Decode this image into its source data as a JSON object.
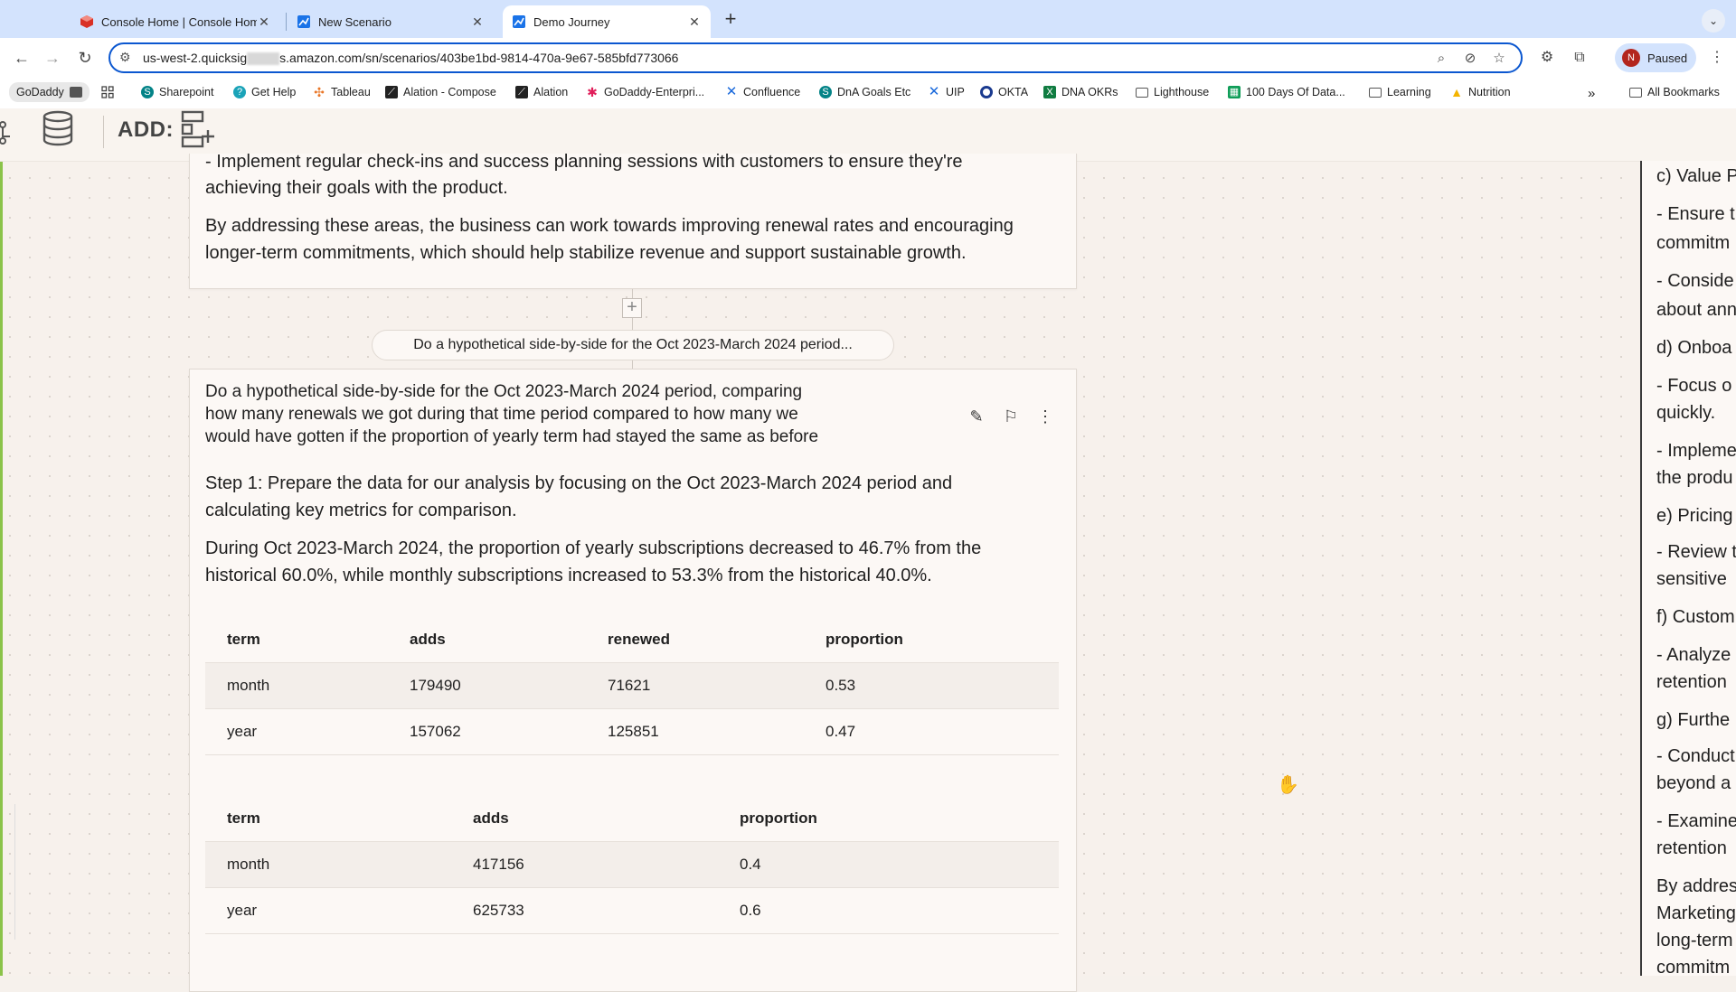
{
  "browser": {
    "tabs": [
      {
        "title": "Console Home | Console Hom",
        "active": false,
        "favicon": "aws-cube-icon",
        "color": "#d93025"
      },
      {
        "title": "New Scenario",
        "active": false,
        "favicon": "quicksight-icon",
        "color": "#1a73e8"
      },
      {
        "title": "Demo Journey",
        "active": true,
        "favicon": "quicksight-icon",
        "color": "#1a73e8"
      }
    ],
    "url_prefix": "us-west-2.quicksig",
    "url_suffix": "s.amazon.com/sn/scenarios/403be1bd-9814-470a-9e67-585bfd773066",
    "profile_initial": "N",
    "profile_status": "Paused",
    "bookmarks": [
      {
        "label": "GoDaddy",
        "icon": "godaddy-icon"
      },
      {
        "label": "Sharepoint",
        "icon": "sharepoint-icon",
        "color": "#038387"
      },
      {
        "label": "Get Help",
        "icon": "help-icon",
        "color": "#1aa3b8"
      },
      {
        "label": "Tableau",
        "icon": "tableau-icon",
        "color": "#e97627"
      },
      {
        "label": "Alation - Compose",
        "icon": "alation-icon",
        "color": "#222222"
      },
      {
        "label": "Alation",
        "icon": "alation-icon",
        "color": "#222222"
      },
      {
        "label": "GoDaddy-Enterpri...",
        "icon": "slack-icon",
        "color": "#e01e5a"
      },
      {
        "label": "Confluence",
        "icon": "confluence-icon",
        "color": "#1868db"
      },
      {
        "label": "DnA Goals Etc",
        "icon": "sharepoint-icon",
        "color": "#038387"
      },
      {
        "label": "UIP",
        "icon": "confluence-icon",
        "color": "#1868db"
      },
      {
        "label": "OKTA",
        "icon": "okta-icon",
        "color": "#1a3a8f"
      },
      {
        "label": "DNA OKRs",
        "icon": "excel-icon",
        "color": "#107c41"
      },
      {
        "label": "Lighthouse",
        "icon": "folder-icon"
      },
      {
        "label": "100 Days Of Data...",
        "icon": "sheets-icon",
        "color": "#0f9d58"
      },
      {
        "label": "Learning",
        "icon": "folder-icon"
      },
      {
        "label": "Nutrition",
        "icon": "drive-icon",
        "color": "#f4b400"
      }
    ],
    "more_bookmarks": "»",
    "all_bookmarks": "All Bookmarks"
  },
  "toolbar": {
    "add_label": "ADD:"
  },
  "top_card": {
    "line1": "- Implement regular check-ins and success planning sessions with customers to ensure they're",
    "line2": "achieving their goals with the product.",
    "para2_line1": "By addressing these areas, the business can work towards improving renewal rates and encouraging",
    "para2_line2": "longer-term commitments, which should help stabilize revenue and support sustainable growth."
  },
  "question_pill": "Do a hypothetical side-by-side for the Oct 2023-March 2024 period...",
  "answer_card": {
    "question_lines": [
      "Do a hypothetical side-by-side for the Oct 2023-March 2024 period, comparing",
      "how many renewals we got during that time period compared to how many we",
      "would have gotten if the proportion of yearly term had stayed the same as before"
    ],
    "step1_lines": [
      "Step 1: Prepare the data for our analysis by focusing on the Oct 2023-March 2024 period and",
      "calculating key metrics for comparison."
    ],
    "summary_lines": [
      "During Oct 2023-March 2024, the proportion of yearly subscriptions decreased to 46.7% from the",
      "historical 60.0%, while monthly subscriptions increased to 53.3% from the historical 40.0%."
    ],
    "table1": {
      "headers": [
        "term",
        "adds",
        "renewed",
        "proportion"
      ],
      "rows": [
        [
          "month",
          "179490",
          "71621",
          "0.53"
        ],
        [
          "year",
          "157062",
          "125851",
          "0.47"
        ]
      ]
    },
    "table2": {
      "headers": [
        "term",
        "adds",
        "proportion"
      ],
      "rows": [
        [
          "month",
          "417156",
          "0.4"
        ],
        [
          "year",
          "625733",
          "0.6"
        ]
      ]
    }
  },
  "right_panel": {
    "lines": [
      "c) Value P",
      "- Ensure t",
      "commitm",
      "- Conside",
      "about ann",
      "d) Onboa",
      "- Focus o",
      "quickly.",
      "- Impleme",
      "the produ",
      "e) Pricing",
      "- Review t",
      "sensitive",
      "f) Custom",
      "- Analyze",
      "retention",
      "g) Furthe",
      "- Conduct",
      "beyond a",
      "- Examine",
      "retention",
      "By addres",
      "Marketing",
      "long-term",
      "commitm"
    ]
  }
}
